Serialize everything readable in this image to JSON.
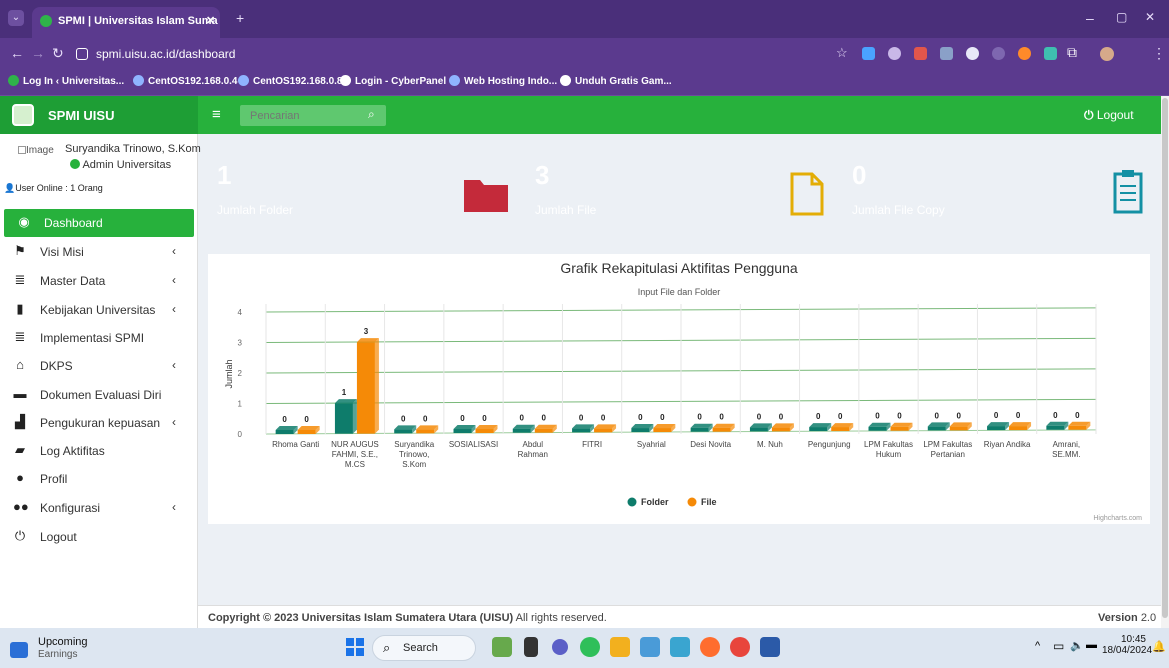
{
  "browser": {
    "tab_title": "SPMI | Universitas Islam Suma",
    "url": "spmi.uisu.ac.id/dashboard",
    "bookmarks": [
      "Log In ‹ Universitas...",
      "CentOS192.168.0.4",
      "CentOS192.168.0.8",
      "Login - CyberPanel",
      "Web Hosting Indo...",
      "Unduh Gratis Gam..."
    ]
  },
  "app": {
    "brand": "SPMI UISU",
    "search_placeholder": "Pencarian",
    "logout_label": "Logout",
    "user": {
      "avatar_alt": "Image",
      "name": "Suryandika Trinowo, S.Kom",
      "role": "Admin Universitas",
      "online": "User Online : 1 Orang"
    },
    "menu": [
      {
        "label": "Dashboard",
        "icon": "dashboard-icon",
        "active": true,
        "sub": false
      },
      {
        "label": "Visi Misi",
        "icon": "flag-icon",
        "active": false,
        "sub": true
      },
      {
        "label": "Master Data",
        "icon": "database-icon",
        "active": false,
        "sub": true
      },
      {
        "label": "Kebijakan Universitas",
        "icon": "file-icon",
        "active": false,
        "sub": true
      },
      {
        "label": "Implementasi SPMI",
        "icon": "database-icon",
        "active": false,
        "sub": false
      },
      {
        "label": "DKPS",
        "icon": "institution-icon",
        "active": false,
        "sub": true
      },
      {
        "label": "Dokumen Evaluasi Diri",
        "icon": "folder-icon",
        "active": false,
        "sub": false
      },
      {
        "label": "Pengukuran kepuasan",
        "icon": "bar-chart-icon",
        "active": false,
        "sub": true
      },
      {
        "label": "Log Aktifitas",
        "icon": "folder-open-icon",
        "active": false,
        "sub": false
      },
      {
        "label": "Profil",
        "icon": "user-icon",
        "active": false,
        "sub": false
      },
      {
        "label": "Konfigurasi",
        "icon": "users-icon",
        "active": false,
        "sub": true
      },
      {
        "label": "Logout",
        "icon": "power-icon",
        "active": false,
        "sub": false
      }
    ],
    "cards": [
      {
        "value": "1",
        "label": "Jumlah Folder",
        "color": "#dd3445",
        "icon": "folder-icon"
      },
      {
        "value": "3",
        "label": "Jumlah File",
        "color": "#fdc008",
        "icon": "file-icon"
      },
      {
        "value": "0",
        "label": "Jumlah File Copy",
        "color": "#17a2b8",
        "icon": "clipboard-icon"
      }
    ],
    "footer": {
      "copyright": "Copyright © 2023 Universitas Islam Sumatera Utara (UISU)",
      "rights": "All rights reserved.",
      "version_label": "Version",
      "version": "2.0"
    }
  },
  "chart_data": {
    "type": "bar",
    "title": "Grafik Rekapitulasi Aktifitas Pengguna",
    "subtitle": "Input File dan Folder",
    "ylabel": "Jumlah",
    "ylim": [
      0,
      4
    ],
    "yticks": [
      0,
      1,
      2,
      3,
      4
    ],
    "categories": [
      "Rhoma Ganti",
      "NUR AUGUS FAHMI, S.E., M.CS",
      "Suryandika Trinowo, S.Kom",
      "SOSIALISASI",
      "Abdul Rahman",
      "FITRI",
      "Syahrial",
      "Desi Novita",
      "M. Nuh",
      "Pengunjung",
      "LPM Fakultas Hukum",
      "LPM Fakultas Pertanian",
      "Riyan Andika",
      "Amrani, SE.MM."
    ],
    "category_lines": [
      [
        "Rhoma Ganti"
      ],
      [
        "NUR AUGUS",
        "FAHMI, S.E.,",
        "M.CS"
      ],
      [
        "Suryandika",
        "Trinowo,",
        "S.Kom"
      ],
      [
        "SOSIALISASI"
      ],
      [
        "Abdul",
        "Rahman"
      ],
      [
        "FITRI"
      ],
      [
        "Syahrial"
      ],
      [
        "Desi Novita"
      ],
      [
        "M. Nuh"
      ],
      [
        "Pengunjung"
      ],
      [
        "LPM Fakultas",
        "Hukum"
      ],
      [
        "LPM Fakultas",
        "Pertanian"
      ],
      [
        "Riyan Andika"
      ],
      [
        "Amrani,",
        "SE.MM."
      ]
    ],
    "series": [
      {
        "name": "Folder",
        "color": "#0e7c6b",
        "values": [
          0,
          1,
          0,
          0,
          0,
          0,
          0,
          0,
          0,
          0,
          0,
          0,
          0,
          0
        ]
      },
      {
        "name": "File",
        "color": "#f58a07",
        "values": [
          0,
          3,
          0,
          0,
          0,
          0,
          0,
          0,
          0,
          0,
          0,
          0,
          0,
          0
        ]
      }
    ],
    "credits": "Highcharts.com",
    "legend_position": "bottom"
  },
  "taskbar": {
    "widget_title": "Upcoming",
    "widget_sub": "Earnings",
    "search_label": "Search",
    "time": "10:45",
    "date": "18/04/2024"
  }
}
